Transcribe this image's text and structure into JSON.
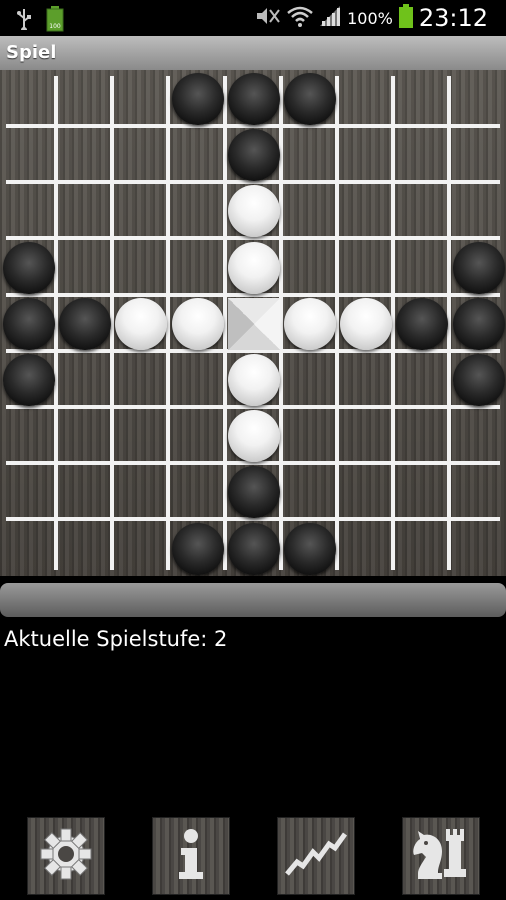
{
  "status_bar": {
    "battery_percent_text": "100%",
    "time": "23:12",
    "icons": [
      "usb-icon",
      "battery-small-icon",
      "mute-icon",
      "wifi-icon",
      "signal-icon",
      "battery-icon"
    ]
  },
  "action_bar": {
    "title": "Spiel"
  },
  "board": {
    "size": 9,
    "pieces": [
      {
        "row": 0,
        "col": 3,
        "color": "black"
      },
      {
        "row": 0,
        "col": 4,
        "color": "black"
      },
      {
        "row": 0,
        "col": 5,
        "color": "black"
      },
      {
        "row": 1,
        "col": 4,
        "color": "black"
      },
      {
        "row": 2,
        "col": 4,
        "color": "white"
      },
      {
        "row": 3,
        "col": 0,
        "color": "black"
      },
      {
        "row": 3,
        "col": 4,
        "color": "white"
      },
      {
        "row": 3,
        "col": 8,
        "color": "black"
      },
      {
        "row": 4,
        "col": 0,
        "color": "black"
      },
      {
        "row": 4,
        "col": 1,
        "color": "black"
      },
      {
        "row": 4,
        "col": 2,
        "color": "white"
      },
      {
        "row": 4,
        "col": 3,
        "color": "white"
      },
      {
        "row": 4,
        "col": 5,
        "color": "white"
      },
      {
        "row": 4,
        "col": 6,
        "color": "white"
      },
      {
        "row": 4,
        "col": 7,
        "color": "black"
      },
      {
        "row": 4,
        "col": 8,
        "color": "black"
      },
      {
        "row": 5,
        "col": 0,
        "color": "black"
      },
      {
        "row": 5,
        "col": 4,
        "color": "white"
      },
      {
        "row": 5,
        "col": 8,
        "color": "black"
      },
      {
        "row": 6,
        "col": 4,
        "color": "white"
      },
      {
        "row": 7,
        "col": 4,
        "color": "black"
      },
      {
        "row": 8,
        "col": 3,
        "color": "black"
      },
      {
        "row": 8,
        "col": 4,
        "color": "black"
      },
      {
        "row": 8,
        "col": 5,
        "color": "black"
      }
    ],
    "center_tile": {
      "row": 4,
      "col": 4
    }
  },
  "level_text": "Aktuelle Spielstufe: 2",
  "bottom_buttons": [
    {
      "name": "settings-button",
      "icon": "gear-icon"
    },
    {
      "name": "info-button",
      "icon": "info-icon"
    },
    {
      "name": "statistics-button",
      "icon": "chart-line-icon"
    },
    {
      "name": "game-pieces-button",
      "icon": "chess-pieces-icon"
    }
  ]
}
